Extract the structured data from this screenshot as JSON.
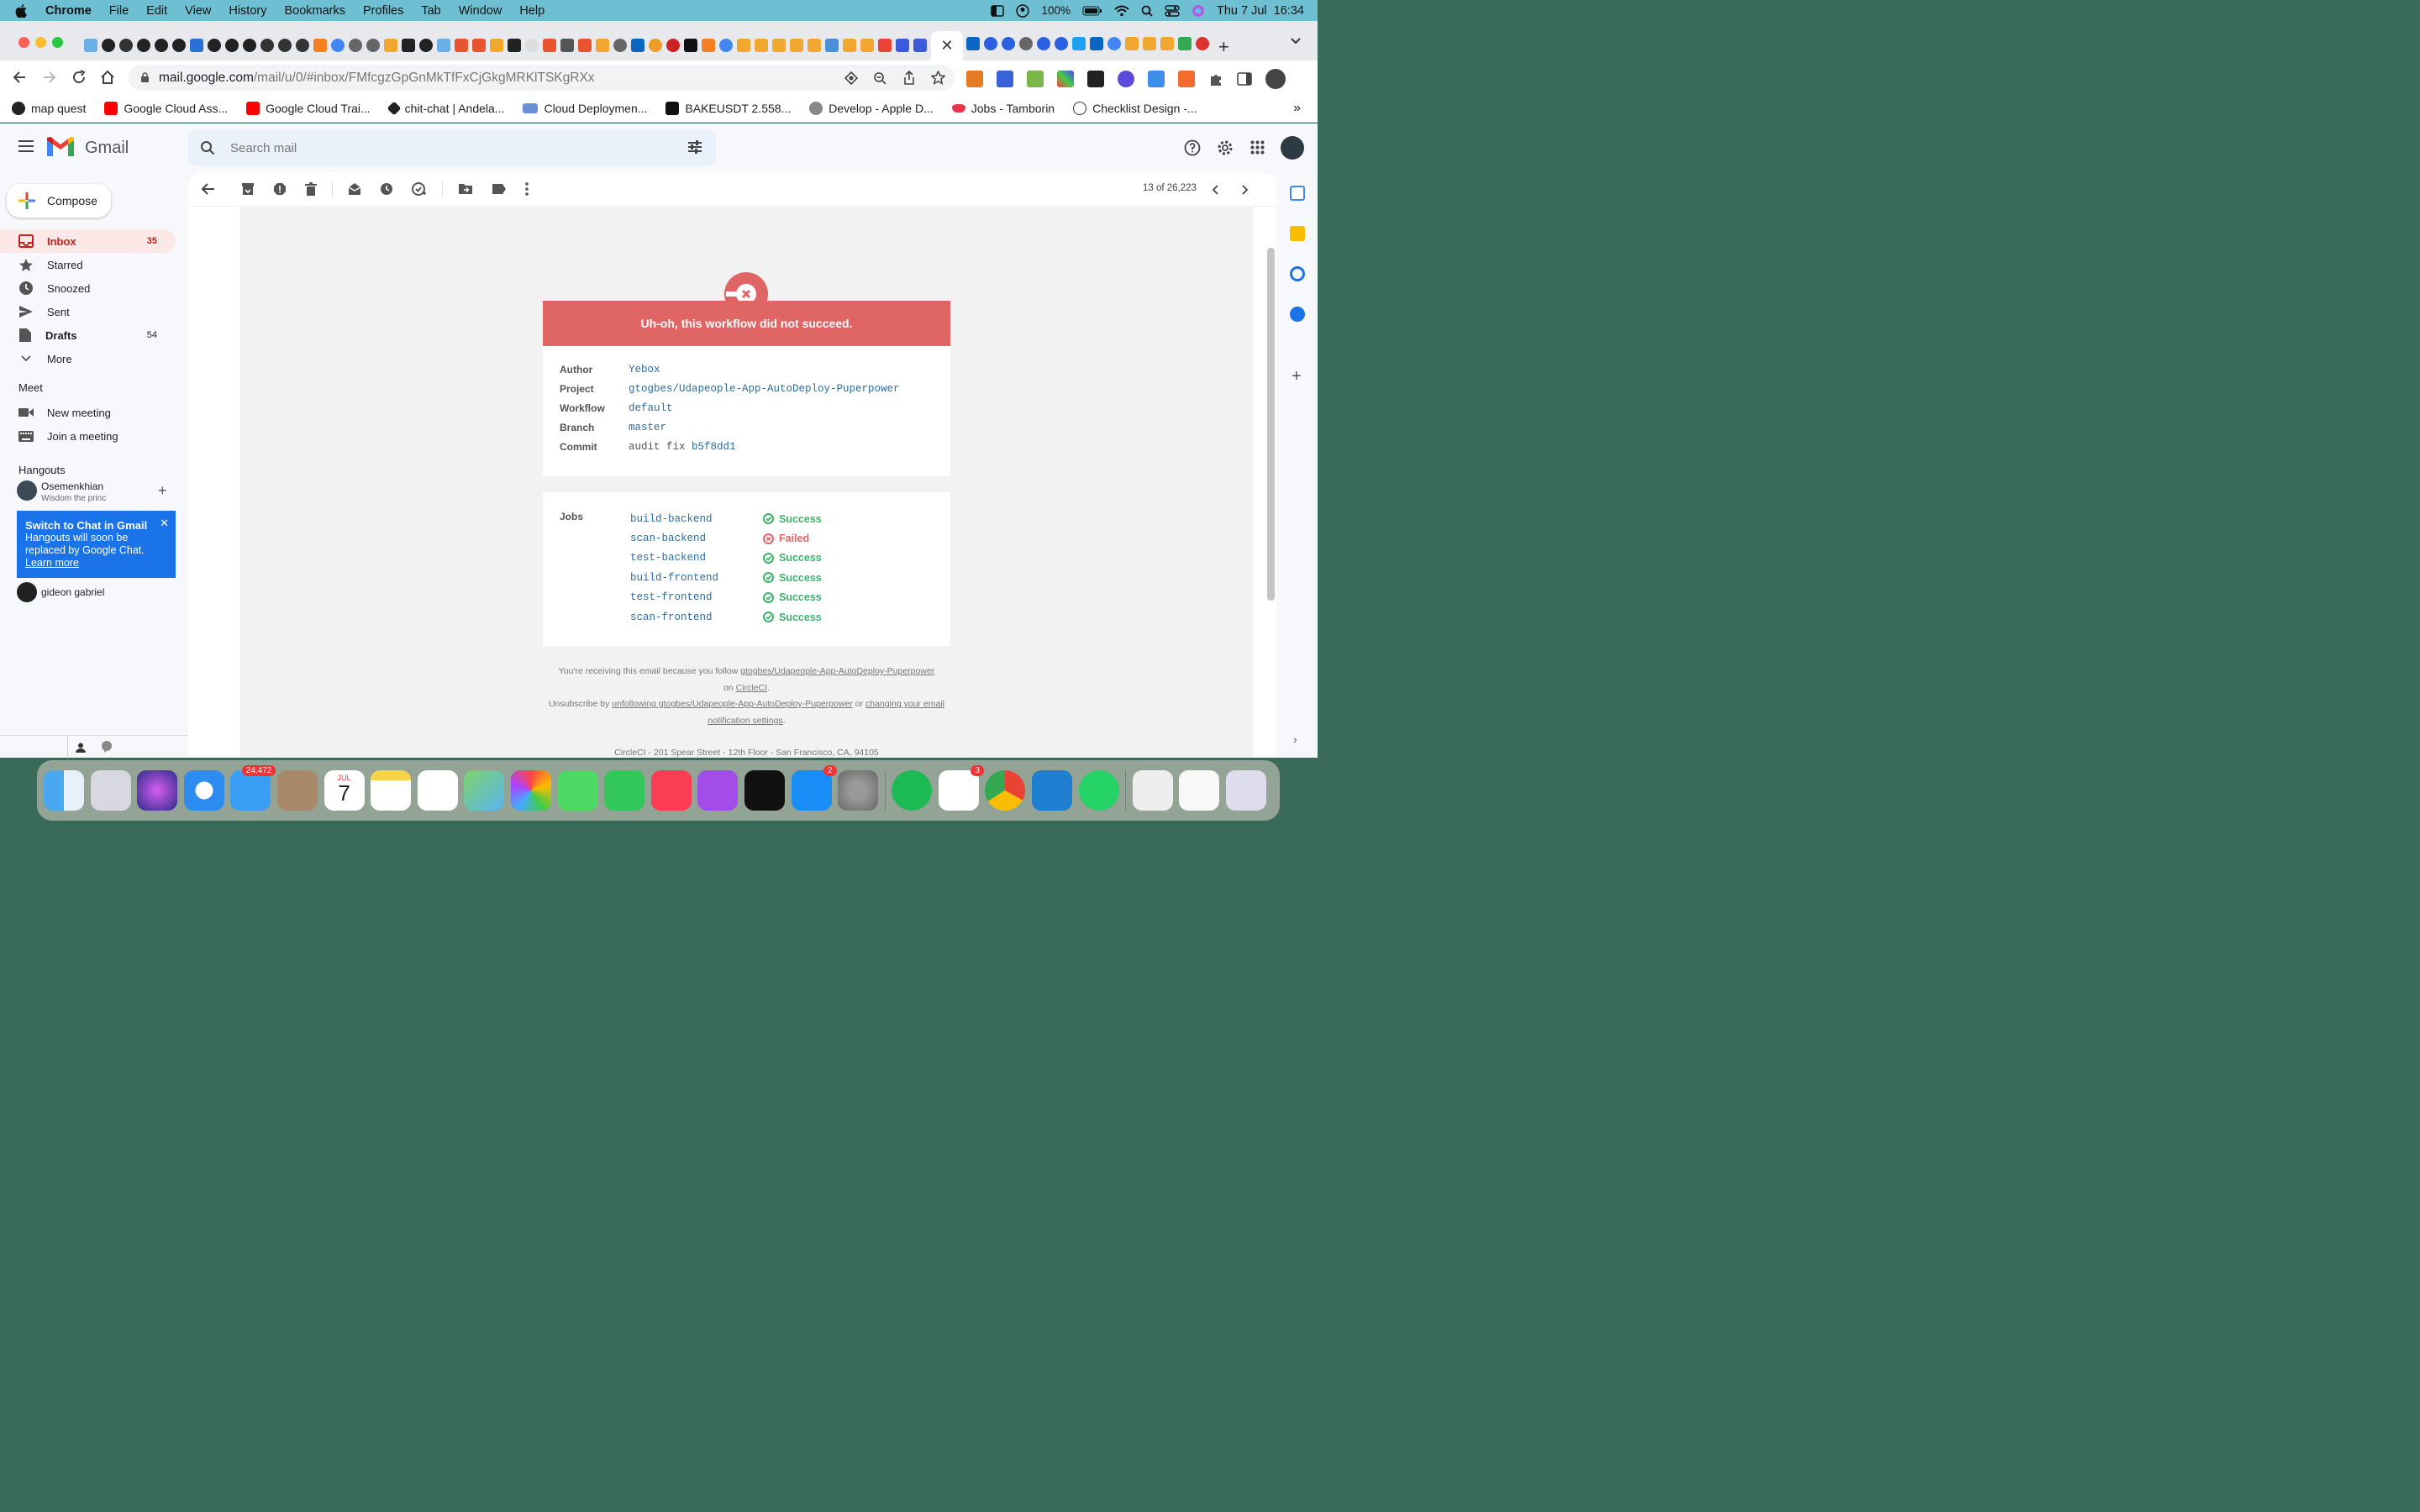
{
  "menubar": {
    "app_name": "Chrome",
    "menus": [
      "File",
      "Edit",
      "View",
      "History",
      "Bookmarks",
      "Profiles",
      "Tab",
      "Window",
      "Help"
    ],
    "battery": "100%",
    "datetime": "Thu 7 Jul  16:34"
  },
  "browser": {
    "url_host": "mail.google.com",
    "url_path": "/mail/u/0/#inbox/FMfcgzGpGnMkTfFxCjGkgMRKlTSKgRXx",
    "bookmarks": [
      "map quest",
      "Google Cloud Ass...",
      "Google Cloud Trai...",
      "chit-chat | Andela...",
      "Cloud Deploymen...",
      "BAKEUSDT 2.558...",
      "Develop - Apple D...",
      "Jobs - Tamborin",
      "Checklist Design -..."
    ],
    "bookmarks_more": "»"
  },
  "gmail": {
    "logo_text": "Gmail",
    "search_placeholder": "Search mail",
    "compose_label": "Compose",
    "nav": [
      {
        "label": "Inbox",
        "count": "35"
      },
      {
        "label": "Starred",
        "count": ""
      },
      {
        "label": "Snoozed",
        "count": ""
      },
      {
        "label": "Sent",
        "count": ""
      },
      {
        "label": "Drafts",
        "count": "54"
      },
      {
        "label": "More",
        "count": ""
      }
    ],
    "meet": {
      "title": "Meet",
      "items": [
        "New meeting",
        "Join a meeting"
      ]
    },
    "hangouts": {
      "title": "Hangouts",
      "user_name": "Osemenkhian",
      "user_status": "Wisdom the princip",
      "toast_title": "Switch to Chat in Gmail",
      "toast_body": "Hangouts will soon be replaced by Google Chat.",
      "toast_link": "Learn more",
      "contact": "gideon gabriel"
    },
    "pagination": "13 of 26,223"
  },
  "email": {
    "banner": "Uh-oh, this workflow did not succeed.",
    "details": [
      {
        "key": "Author",
        "value": "Yebox"
      },
      {
        "key": "Project",
        "value": "gtogbes/Udapeople-App-AutoDeploy-Puperpower"
      },
      {
        "key": "Workflow",
        "value": "default"
      },
      {
        "key": "Branch",
        "value": "master"
      },
      {
        "key": "Commit",
        "prefix": "audit fix ",
        "value": "b5f8dd1"
      }
    ],
    "jobs_label": "Jobs",
    "jobs": [
      {
        "name": "build-backend",
        "status": "Success"
      },
      {
        "name": "scan-backend",
        "status": "Failed"
      },
      {
        "name": "test-backend",
        "status": "Success"
      },
      {
        "name": "build-frontend",
        "status": "Success"
      },
      {
        "name": "test-frontend",
        "status": "Success"
      },
      {
        "name": "scan-frontend",
        "status": "Success"
      }
    ],
    "colors": {
      "success": "#3fb26d",
      "failed": "#e06565",
      "link": "#2d6ca2",
      "banner": "#e06565"
    },
    "footer": {
      "line1": "You're receiving this email because you follow ",
      "project_link": "gtogbes/Udapeople-App-AutoDeploy-Puperpower",
      "on": "on ",
      "circleci": "CircleCI",
      "unsub": "Unsubscribe by ",
      "unfollow_link": "unfollowing gtogbes/Udapeople-App-AutoDeploy-Puperpower",
      "or": " or ",
      "settings_link": "changing your email notification settings",
      "address": "CircleCI - 201 Spear Street - 12th Floor - San Francisco, CA, 94105"
    }
  },
  "dock": {
    "mail_badge": "24,472",
    "calendar_month": "JUL",
    "calendar_day": "7",
    "appstore_badge": "2",
    "slack_badge": "3"
  }
}
